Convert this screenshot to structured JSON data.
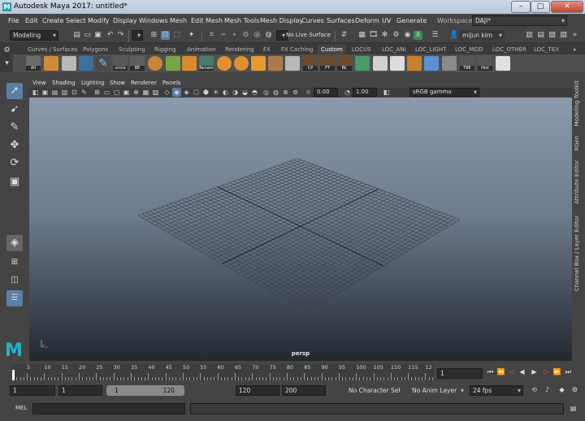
{
  "title": "Autodesk Maya 2017: untitled*",
  "logo_letter": "M",
  "window_buttons": {
    "minimize": "–",
    "maximize": "□",
    "close": "✕"
  },
  "menu": [
    "File",
    "Edit",
    "Create",
    "Select",
    "Modify",
    "Display",
    "Windows",
    "Mesh",
    "Edit Mesh",
    "Mesh Tools",
    "Mesh Display",
    "Curves",
    "Surfaces",
    "Deform",
    "UV",
    "Generate"
  ],
  "workspace": {
    "label": "Workspace :",
    "value": "DAJI*"
  },
  "status": {
    "mode": "Modeling",
    "live_surface": "No Live Surface",
    "user": "mijun kim"
  },
  "shelf_tabs": [
    "Curves / Surfaces",
    "Polygons",
    "Sculpting",
    "Rigging",
    "Animation",
    "Rendering",
    "FX",
    "FX Caching",
    "Custom",
    "LOCUS",
    "LOC_ANI",
    "LOC_LIGHT",
    "LOC_MOD",
    "LOC_OTHER",
    "LOC_TEX"
  ],
  "active_shelf_tab": "Custom",
  "shelf_labels": [
    "All",
    "",
    "",
    "circle",
    "BE",
    "",
    "Renam",
    "",
    "",
    "",
    "",
    "CP",
    "FT",
    "BC",
    "",
    "",
    "",
    "",
    "",
    "TBE",
    "Hist",
    ""
  ],
  "panel_menu": [
    "View",
    "Shading",
    "Lighting",
    "Show",
    "Renderer",
    "Panels"
  ],
  "viewport": {
    "camera": "persp",
    "exposure": "0.00",
    "gamma": "1.00",
    "color_space": "sRGB gamma"
  },
  "right_tabs": [
    "Modeling Toolkit",
    "XGen",
    "Attribute Editor",
    "Channel Box / Layer Editor"
  ],
  "timeline": {
    "ticks": [
      "5",
      "10",
      "15",
      "20",
      "25",
      "30",
      "35",
      "40",
      "45",
      "50",
      "55",
      "60",
      "65",
      "70",
      "75",
      "80",
      "85",
      "90",
      "95",
      "100",
      "105",
      "110",
      "115",
      "12"
    ],
    "current_frame": "1"
  },
  "range": {
    "start": "1",
    "playback_start": "1",
    "slider_start": "1",
    "slider_end": "120",
    "playback_end": "120",
    "end": "200",
    "character_set": "No Character Set",
    "anim_layer": "No Anim Layer",
    "fps": "24 fps"
  },
  "command": {
    "label": "MEL"
  },
  "colors": {
    "accent": "#5a7ea8",
    "maya_logo": "#20b4c8"
  }
}
